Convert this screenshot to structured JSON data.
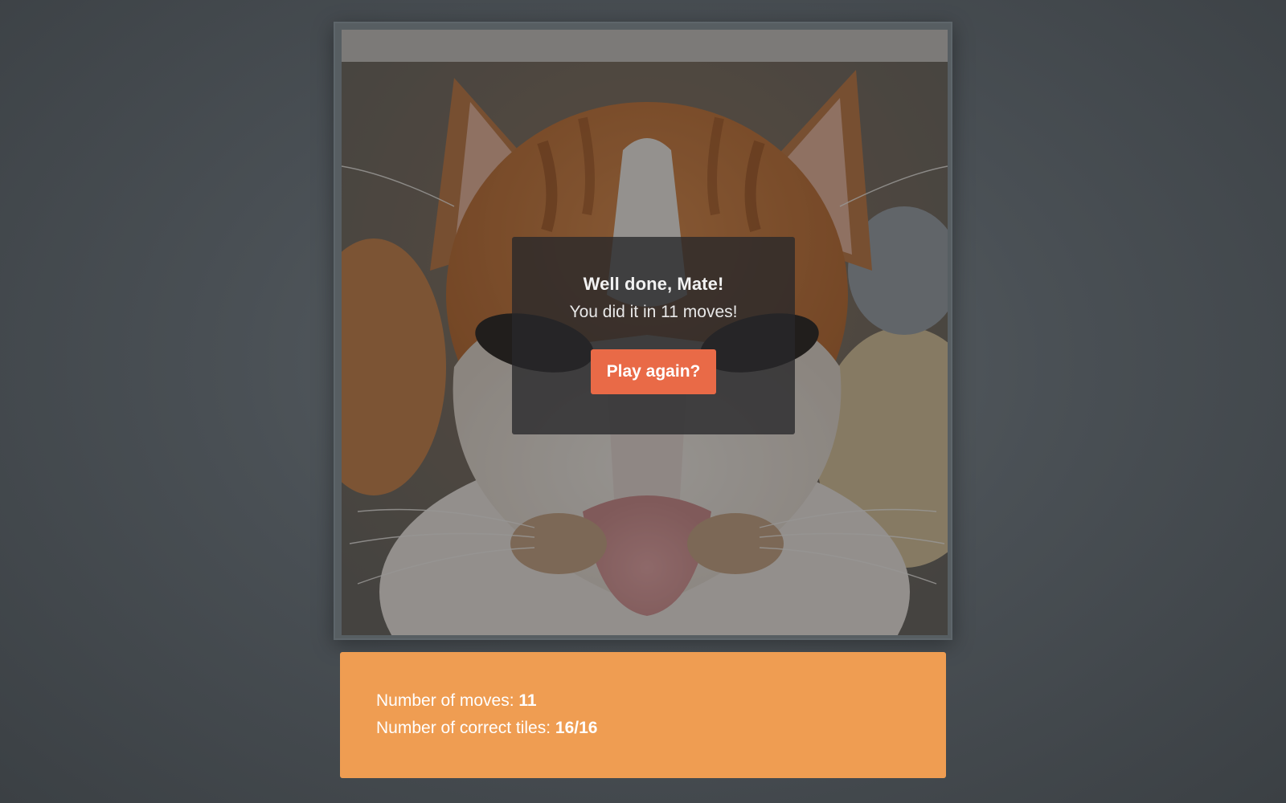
{
  "dialog": {
    "title": "Well done, Mate!",
    "message": "You did it in 11 moves!",
    "play_again_label": "Play again?"
  },
  "stats": {
    "moves_label": "Number of moves: ",
    "moves_value": "11",
    "tiles_label": "Number of correct tiles: ",
    "tiles_value": "16/16"
  },
  "colors": {
    "background": "#474d51",
    "accent_button": "#e96a47",
    "stats_panel": "#ef9d52"
  },
  "puzzle": {
    "image_subject": "orange and white cat face",
    "tiles_correct": 16,
    "tiles_total": 16,
    "solved": true
  }
}
